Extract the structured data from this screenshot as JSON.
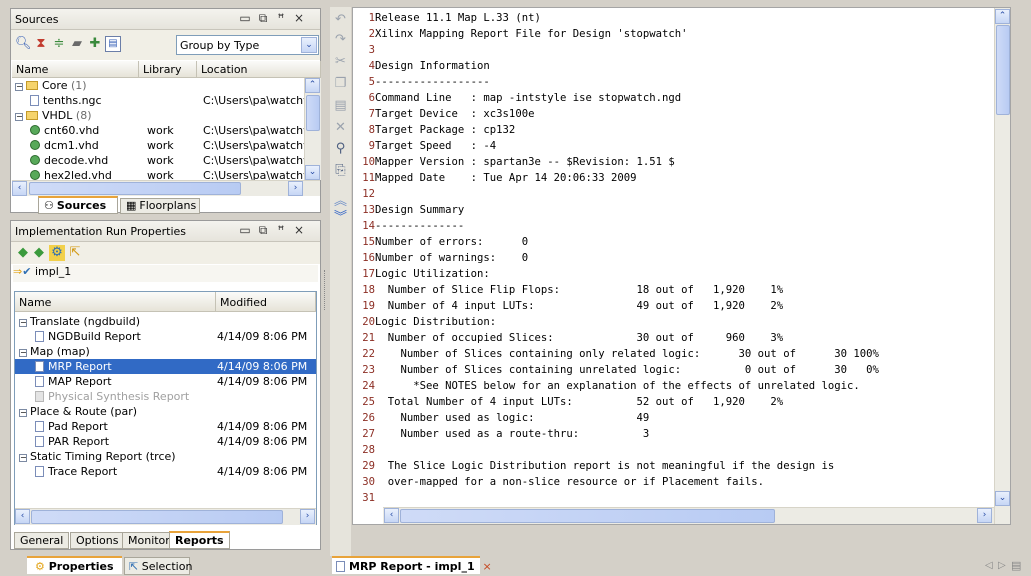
{
  "sources": {
    "title": "Sources",
    "group_by": "Group by Type",
    "columns": [
      "Name",
      "Library",
      "Location"
    ],
    "rows": [
      {
        "name": "Core",
        "count": "(1)",
        "library": "",
        "location": "",
        "kind": "folder"
      },
      {
        "name": "tenths.ngc",
        "count": "",
        "library": "",
        "location": "C:\\Users\\pa\\watchvl",
        "kind": "file"
      },
      {
        "name": "VHDL",
        "count": "(8)",
        "library": "",
        "location": "",
        "kind": "folder"
      },
      {
        "name": "cnt60.vhd",
        "count": "",
        "library": "work",
        "location": "C:\\Users\\pa\\watchvl",
        "kind": "vhdl"
      },
      {
        "name": "dcm1.vhd",
        "count": "",
        "library": "work",
        "location": "C:\\Users\\pa\\watchvl",
        "kind": "vhdl"
      },
      {
        "name": "decode.vhd",
        "count": "",
        "library": "work",
        "location": "C:\\Users\\pa\\watchvl",
        "kind": "vhdl"
      },
      {
        "name": "hex2led.vhd",
        "count": "",
        "library": "work",
        "location": "C:\\Users\\pa\\watchvl",
        "kind": "vhdl"
      }
    ],
    "tabs": [
      "Sources",
      "Floorplans"
    ]
  },
  "impl": {
    "title": "Implementation Run Properties",
    "run_name": "impl_1",
    "columns": [
      "Name",
      "Modified"
    ],
    "rows": [
      {
        "name": "Translate (ngdbuild)",
        "modified": "",
        "level": 0,
        "state": "normal"
      },
      {
        "name": "NGDBuild Report",
        "modified": "4/14/09 8:06 PM",
        "level": 1,
        "state": "normal"
      },
      {
        "name": "Map (map)",
        "modified": "",
        "level": 0,
        "state": "normal"
      },
      {
        "name": "MRP Report",
        "modified": "4/14/09 8:06 PM",
        "level": 1,
        "state": "selected"
      },
      {
        "name": "MAP Report",
        "modified": "4/14/09 8:06 PM",
        "level": 1,
        "state": "normal"
      },
      {
        "name": "Physical Synthesis Report",
        "modified": "",
        "level": 1,
        "state": "disabled"
      },
      {
        "name": "Place & Route (par)",
        "modified": "",
        "level": 0,
        "state": "normal"
      },
      {
        "name": "Pad Report",
        "modified": "4/14/09 8:06 PM",
        "level": 1,
        "state": "normal"
      },
      {
        "name": "PAR Report",
        "modified": "4/14/09 8:06 PM",
        "level": 1,
        "state": "normal"
      },
      {
        "name": "Static Timing Report (trce)",
        "modified": "",
        "level": 0,
        "state": "normal"
      },
      {
        "name": "Trace Report",
        "modified": "4/14/09 8:06 PM",
        "level": 1,
        "state": "normal"
      }
    ],
    "tabs": [
      "General",
      "Options",
      "Monitor",
      "Reports"
    ],
    "bottom_tabs": [
      "Properties",
      "Selection"
    ]
  },
  "editor": {
    "tab_label": "MRP Report - impl_1",
    "lines": [
      "Release 11.1 Map L.33 (nt)",
      "Xilinx Mapping Report File for Design 'stopwatch'",
      "",
      "Design Information",
      "------------------",
      "Command Line   : map -intstyle ise stopwatch.ngd",
      "Target Device  : xc3s100e",
      "Target Package : cp132",
      "Target Speed   : -4",
      "Mapper Version : spartan3e -- $Revision: 1.51 $",
      "Mapped Date    : Tue Apr 14 20:06:33 2009",
      "",
      "Design Summary",
      "--------------",
      "Number of errors:      0",
      "Number of warnings:    0",
      "Logic Utilization:",
      "  Number of Slice Flip Flops:            18 out of   1,920    1%",
      "  Number of 4 input LUTs:                49 out of   1,920    2%",
      "Logic Distribution:",
      "  Number of occupied Slices:             30 out of     960    3%",
      "    Number of Slices containing only related logic:      30 out of      30 100%",
      "    Number of Slices containing unrelated logic:          0 out of      30   0%",
      "      *See NOTES below for an explanation of the effects of unrelated logic.",
      "  Total Number of 4 input LUTs:          52 out of   1,920    2%",
      "    Number used as logic:                49",
      "    Number used as a route-thru:          3",
      "",
      "  The Slice Logic Distribution report is not meaningful if the design is",
      "  over-mapped for a non-slice resource or if Placement fails.",
      ""
    ]
  }
}
